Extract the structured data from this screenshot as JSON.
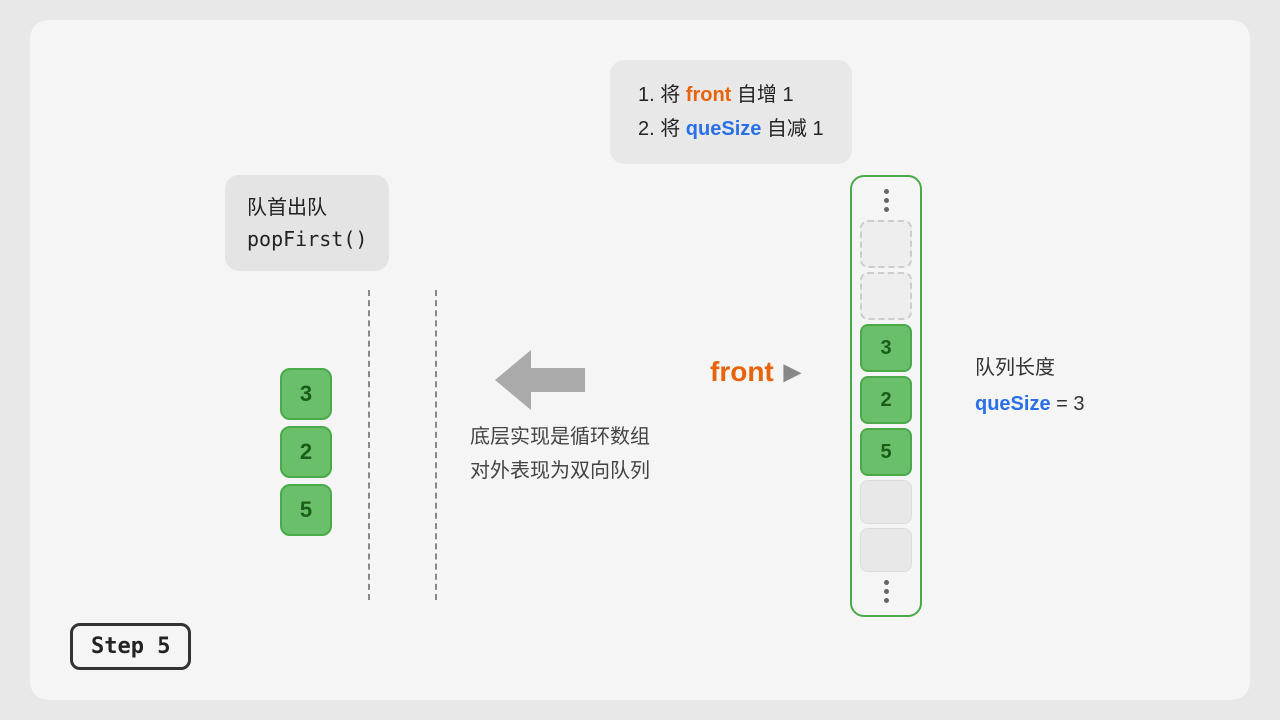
{
  "slide": {
    "background": "#f5f5f5"
  },
  "step_badge": {
    "label": "Step 5"
  },
  "info_box": {
    "line1_pre": "1. 将 ",
    "line1_kw": "front",
    "line1_post": " 自增 1",
    "line2_pre": "2. 将 ",
    "line2_kw": "queSize",
    "line2_post": " 自减 1"
  },
  "popfirst_box": {
    "line1": "队首出队",
    "line2": "popFirst()"
  },
  "left_cells": [
    {
      "value": "3"
    },
    {
      "value": "2"
    },
    {
      "value": "5"
    }
  ],
  "arrow": {
    "direction": "left"
  },
  "desc_text": {
    "line1": "底层实现是循环数组",
    "line2": "对外表现为双向队列"
  },
  "front_label": {
    "text": "front",
    "arrow": "▶"
  },
  "right_cells": [
    {
      "type": "empty"
    },
    {
      "type": "empty"
    },
    {
      "type": "filled",
      "value": "3"
    },
    {
      "type": "filled",
      "value": "2"
    },
    {
      "type": "filled",
      "value": "5"
    },
    {
      "type": "light"
    },
    {
      "type": "light"
    }
  ],
  "queue_info": {
    "label": "队列长度",
    "kw": "queSize",
    "eq": " = 3"
  }
}
